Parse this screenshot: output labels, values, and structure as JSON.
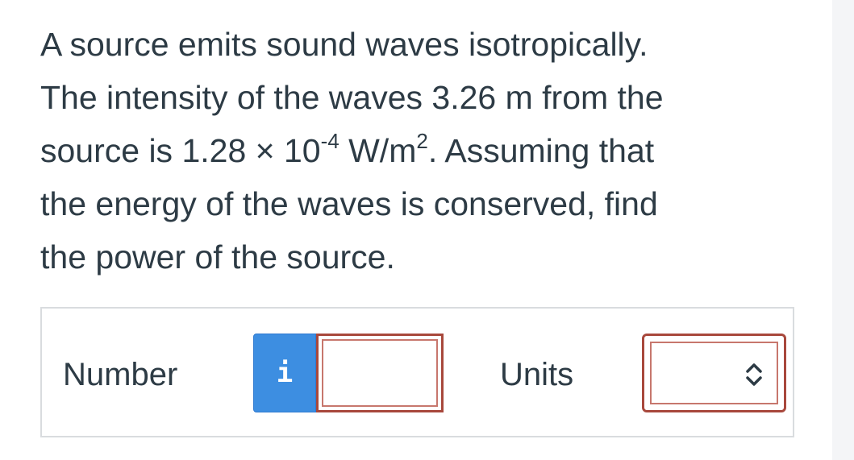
{
  "question": {
    "line1": "A source emits sound waves isotropically.",
    "line2": "The intensity of the waves 3.26 m from the",
    "line3_prefix": "source is 1.28 × 10",
    "line3_exp": "-4",
    "line3_unit": " W/m",
    "line3_unit_exp": "2",
    "line3_suffix": ". Assuming that",
    "line4": "the energy of the waves is conserved, find",
    "line5": "the power of the source."
  },
  "answer": {
    "number_label": "Number",
    "info_button_label": "i",
    "number_value": "",
    "units_label": "Units",
    "units_value": ""
  },
  "colors": {
    "info_button": "#3d8ee1",
    "input_border": "#a8483c",
    "text": "#2d3b45"
  },
  "icons": {
    "info": "info-icon",
    "units_dropdown": "chevron-updown-icon"
  }
}
